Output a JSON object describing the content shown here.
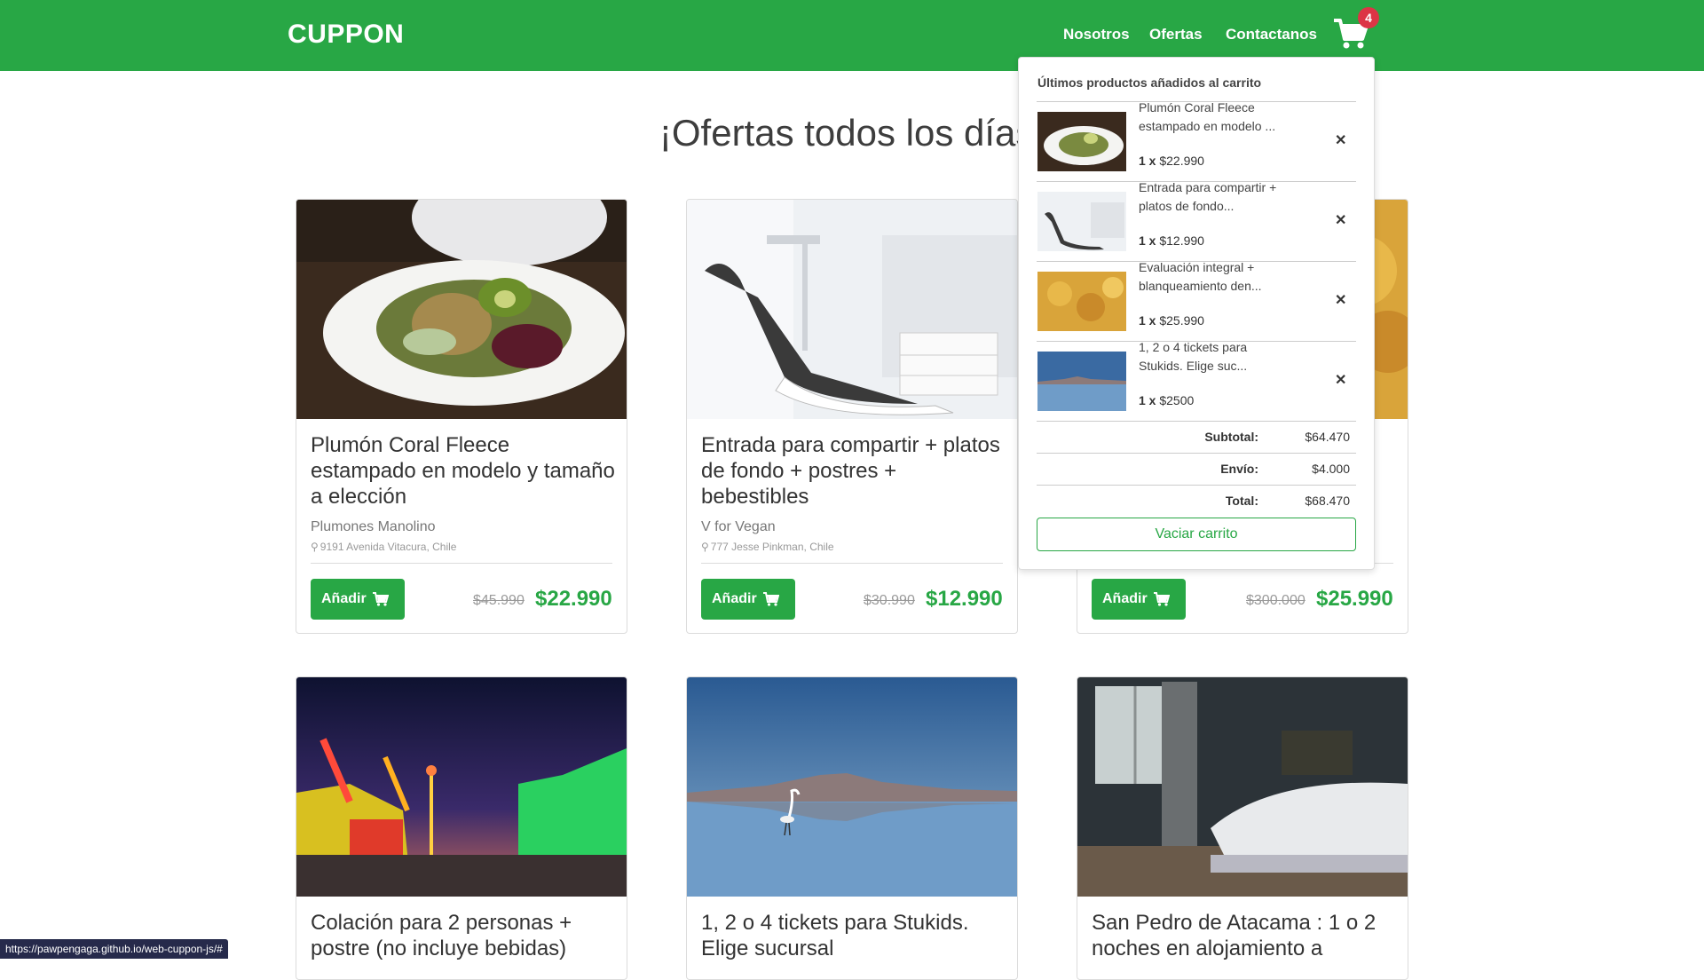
{
  "header": {
    "brand": "CUPPON",
    "nav": [
      "Nosotros",
      "Ofertas",
      "Contactanos"
    ],
    "cart_count": "4"
  },
  "page_title": "¡Ofertas todos los días!",
  "deals": [
    {
      "title": "Plumón Coral Fleece estampado en modelo y tamaño a elección",
      "store": "Plumones Manolino",
      "address": "9191 Avenida Vitacura, Chile",
      "button": "Añadir",
      "old_price": "$45.990",
      "price": "$22.990"
    },
    {
      "title": "Entrada para compartir + platos de fondo + postres + bebestibles",
      "store": "V for Vegan",
      "address": "777 Jesse Pinkman, Chile",
      "button": "Añadir",
      "old_price": "$30.990",
      "price": "$12.990"
    },
    {
      "title": "",
      "store": "",
      "address": "",
      "button": "Añadir",
      "old_price": "$300.000",
      "price": "$25.990"
    },
    {
      "title": "Colación para 2 personas + postre (no incluye bebidas)"
    },
    {
      "title": "1, 2 o 4 tickets para Stukids. Elige sucursal"
    },
    {
      "title": "San Pedro de Atacama : 1 o 2 noches en alojamiento a"
    }
  ],
  "cart_dropdown": {
    "heading": "Últimos productos añadidos al carrito",
    "items": [
      {
        "name": "Plumón Coral Fleece estampado en modelo ...",
        "qty": "1 x",
        "price": "$22.990"
      },
      {
        "name": "Entrada para compartir + platos de fondo...",
        "qty": "1 x",
        "price": "$12.990"
      },
      {
        "name": "Evaluación integral + blanqueamiento den...",
        "qty": "1 x",
        "price": "$25.990"
      },
      {
        "name": "1, 2 o 4 tickets para Stukids. Elige suc...",
        "qty": "1 x",
        "price": "$2500"
      }
    ],
    "subtotal_label": "Subtotal:",
    "subtotal": "$64.470",
    "shipping_label": "Envío:",
    "shipping": "$4.000",
    "total_label": "Total:",
    "total": "$68.470",
    "empty_button": "Vaciar carrito"
  },
  "status_url": "https://pawpengaga.github.io/web-cuppon-js/#",
  "colors": {
    "brand_green": "#28a745",
    "badge_red": "#dc3545"
  }
}
